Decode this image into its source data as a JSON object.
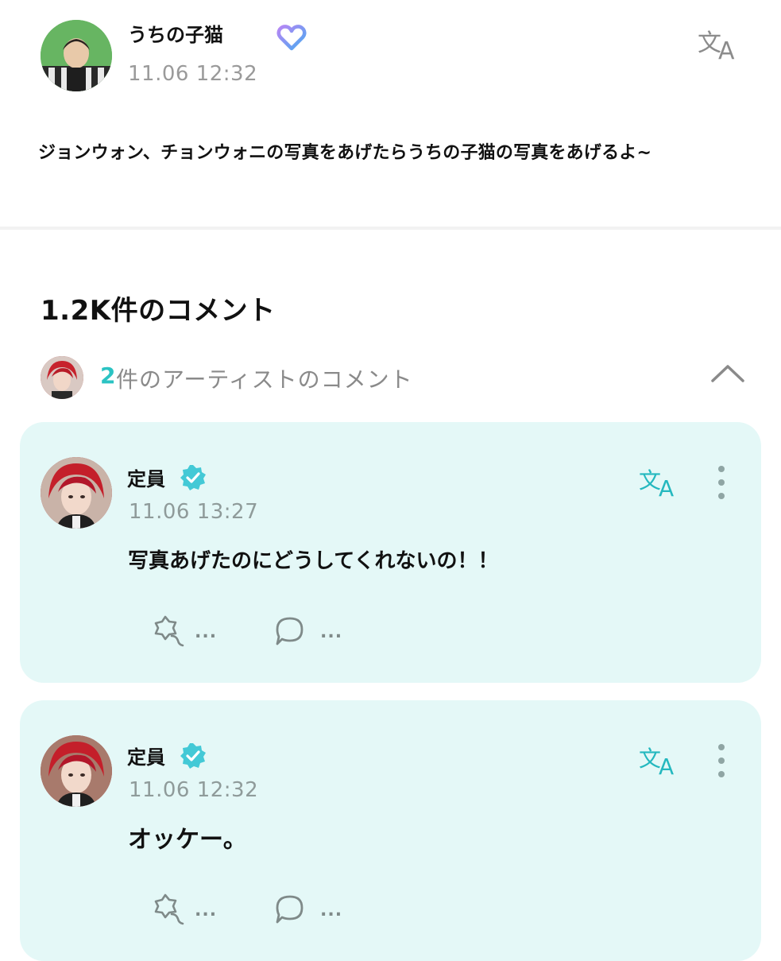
{
  "post": {
    "author_name": "うちの子猫",
    "time": "11.06 12:32",
    "body": "ジョンウォン、チョンウォニの写真をあげたらうちの子猫の写真をあげるよ~",
    "avatar_icon": "user-photo-avatar",
    "badge_icon": "membership-heart-icon",
    "translate_icon": "translate-icon"
  },
  "comments_section": {
    "heading": "1.2K件のコメント",
    "artist_summary": {
      "count": "2",
      "label": "件のアーティストのコメント",
      "chevron_icon": "chevron-up-icon"
    }
  },
  "comments": [
    {
      "author": "定員",
      "time": "11.06 13:27",
      "text": "写真あげたのにどうしてくれないの！！",
      "like_count": "...",
      "reply_count": "..."
    },
    {
      "author": "定員",
      "time": "11.06 12:32",
      "text": "オッケー。",
      "like_count": "...",
      "reply_count": "..."
    }
  ],
  "colors": {
    "accent": "#2bc3c3",
    "card_background": "#e4f8f7",
    "muted_text": "#9a9a9a"
  }
}
